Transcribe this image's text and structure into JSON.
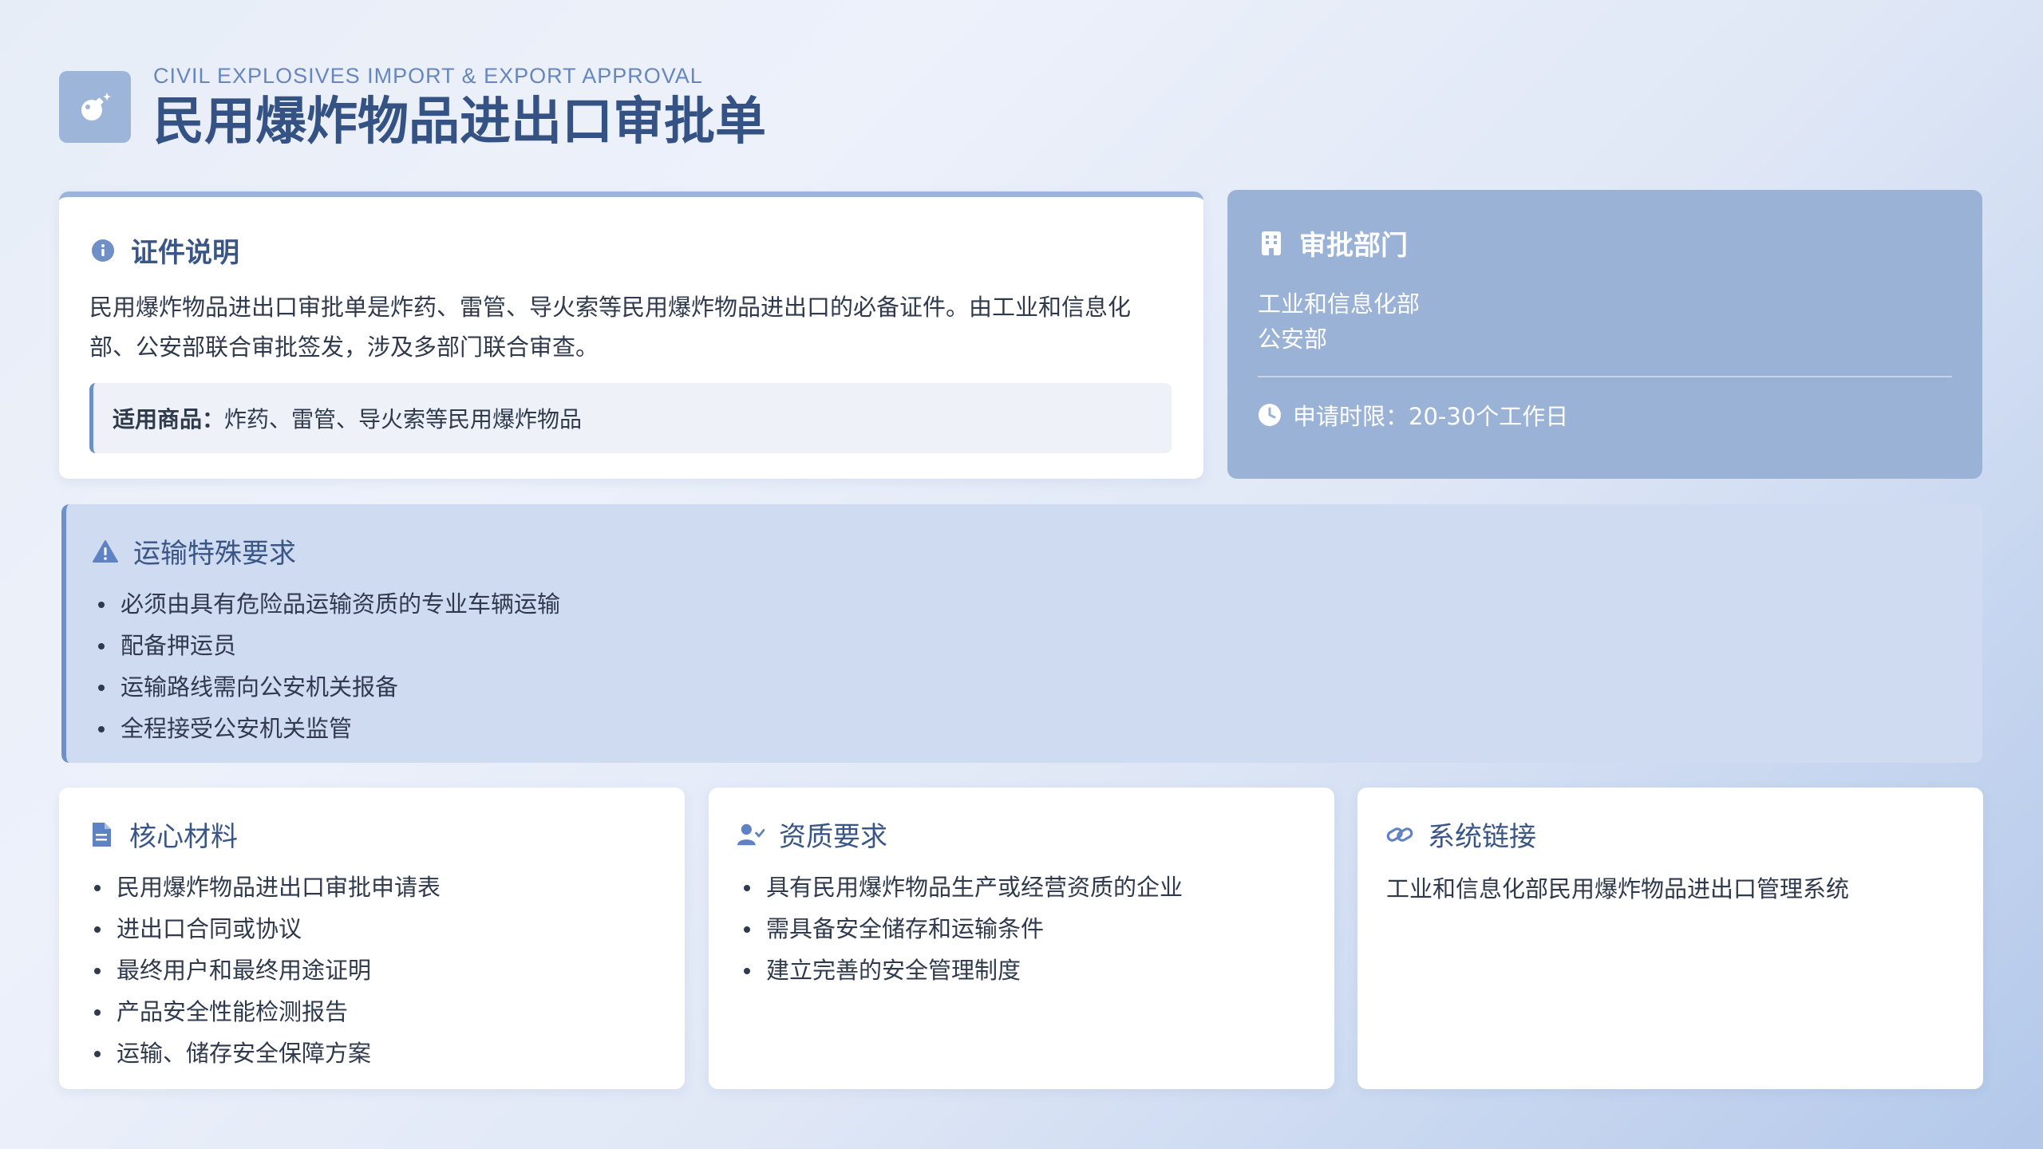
{
  "header": {
    "subtitle": "CIVIL EXPLOSIVES IMPORT & EXPORT APPROVAL",
    "title": "民用爆炸物品进出口审批单",
    "logo_icon": "bomb-icon"
  },
  "intro": {
    "title": "证件说明",
    "icon": "info-icon",
    "paragraph": "民用爆炸物品进出口审批单是炸药、雷管、导火索等民用爆炸物品进出口的必备证件。由工业和信息化部、公安部联合审批签发，涉及多部门联合审查。",
    "applicable_label": "适用商品：",
    "applicable_value": "炸药、雷管、导火索等民用爆炸物品"
  },
  "department": {
    "title": "审批部门",
    "icon": "building-icon",
    "names": [
      "工业和信息化部",
      "公安部"
    ],
    "time_label": "申请时限：",
    "time_value": "20-30个工作日",
    "time_icon": "clock-icon"
  },
  "transport": {
    "title": "运输特殊要求",
    "icon": "warning-icon",
    "items": [
      "必须由具有危险品运输资质的专业车辆运输",
      "配备押运员",
      "运输路线需向公安机关报备",
      "全程接受公安机关监管"
    ]
  },
  "materials": {
    "title": "核心材料",
    "icon": "document-icon",
    "items": [
      "民用爆炸物品进出口审批申请表",
      "进出口合同或协议",
      "最终用户和最终用途证明",
      "产品安全性能检测报告",
      "运输、储存安全保障方案"
    ]
  },
  "qualification": {
    "title": "资质要求",
    "icon": "user-check-icon",
    "items": [
      "具有民用爆炸物品生产或经营资质的企业",
      "需具备安全储存和运输条件",
      "建立完善的安全管理制度"
    ]
  },
  "system": {
    "title": "系统链接",
    "icon": "link-icon",
    "text": "工业和信息化部民用爆炸物品进出口管理系统"
  },
  "colors": {
    "accent": "#6f90c6",
    "title": "#355284",
    "dept_bg": "#9ab2d6",
    "banner_bg": "#cfdbf0"
  }
}
